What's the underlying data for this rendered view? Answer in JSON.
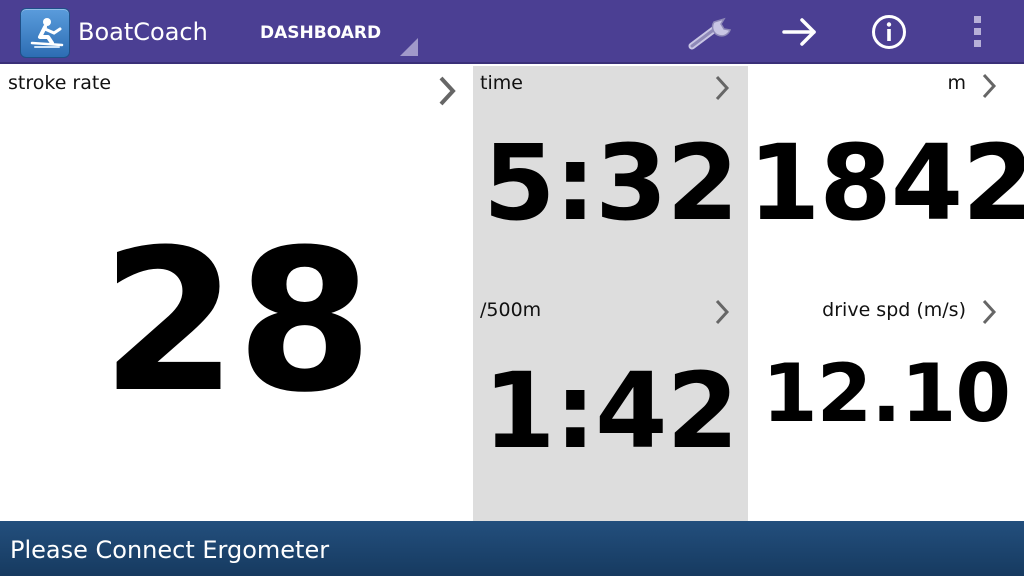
{
  "app": {
    "title": "BoatCoach",
    "nav_selected": "DASHBOARD",
    "icons": {
      "app": "rower-icon",
      "settings": "wrench-icon",
      "forward": "arrow-right-icon",
      "info": "info-icon",
      "overflow": "overflow-menu-icon"
    },
    "colors": {
      "actionbar": "#4b3f93",
      "statusbar": "#1d4670",
      "tile_shaded": "#dddddd",
      "tile_plain": "#ffffff",
      "chevron": "#666666"
    }
  },
  "metrics": {
    "stroke_rate": {
      "label": "stroke rate",
      "value": "28"
    },
    "time": {
      "label": "time",
      "value": "5:32"
    },
    "split": {
      "label": "/500m",
      "value": "1:42"
    },
    "distance": {
      "label": "m",
      "value": "1842"
    },
    "drive_speed": {
      "label": "drive spd (m/s)",
      "value": "12.10"
    }
  },
  "status": {
    "message": "Please Connect Ergometer"
  }
}
